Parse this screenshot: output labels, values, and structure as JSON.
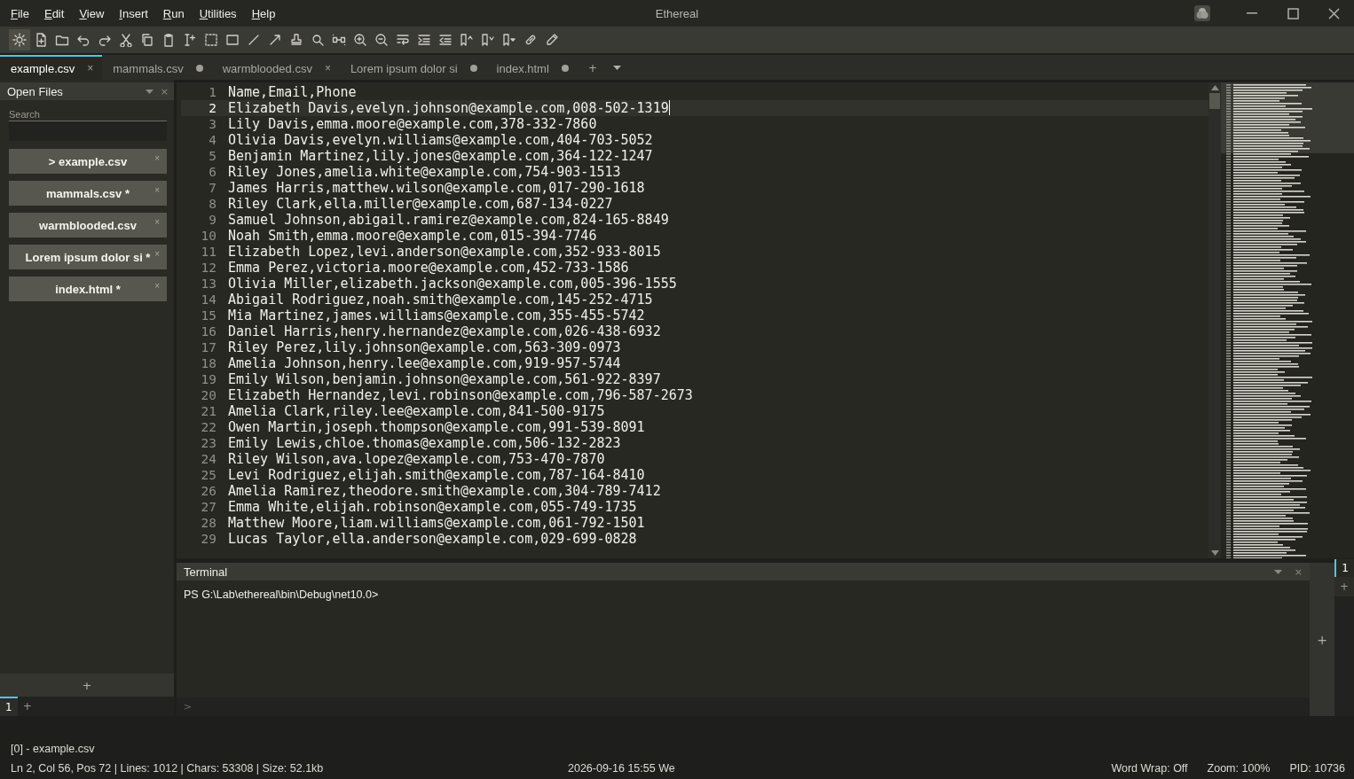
{
  "window": {
    "title": "Ethereal"
  },
  "menu": [
    "File",
    "Edit",
    "View",
    "Insert",
    "Run",
    "Utilities",
    "Help"
  ],
  "toolbar": [
    {
      "selected": true
    },
    {
      "selected": false
    },
    {
      "selected": false
    },
    {
      "selected": false
    },
    {
      "selected": false
    },
    {
      "selected": false
    },
    {
      "selected": false
    },
    {
      "selected": false
    },
    {
      "selected": false
    },
    {
      "selected": false
    },
    {
      "selected": false
    },
    {
      "selected": false
    },
    {
      "selected": false
    },
    {
      "selected": false
    },
    {
      "selected": false
    },
    {
      "selected": false
    },
    {
      "selected": false
    },
    {
      "selected": false
    },
    {
      "selected": false
    },
    {
      "selected": false
    },
    {
      "selected": false
    },
    {
      "selected": false
    },
    {
      "selected": false
    },
    {
      "selected": false
    },
    {
      "selected": false
    },
    {
      "selected": false
    }
  ],
  "tabs": [
    {
      "label": "example.csv",
      "selected": true,
      "kind": "close",
      "close": "×"
    },
    {
      "label": "mammals.csv",
      "selected": false,
      "kind": "modified"
    },
    {
      "label": "warmblooded.csv",
      "selected": false,
      "kind": "close",
      "close": "×"
    },
    {
      "label": "Lorem ipsum dolor si",
      "selected": false,
      "kind": "modified"
    },
    {
      "label": "index.html",
      "selected": false,
      "kind": "modified"
    }
  ],
  "tab_add": "+",
  "sidebar": {
    "title": "Open Files",
    "close": "×",
    "search": {
      "label": "Search"
    },
    "files": [
      {
        "label": "> example.csv",
        "close": "×"
      },
      {
        "label": "mammals.csv *",
        "close": "×"
      },
      {
        "label": "warmblooded.csv",
        "close": "×"
      },
      {
        "label": "Lorem ipsum dolor si *",
        "close": "×"
      },
      {
        "label": "index.html *",
        "close": "×"
      }
    ],
    "add": "+",
    "tabs": [
      {
        "label": "1",
        "selected": true
      }
    ],
    "tab_add": "+"
  },
  "editor": {
    "lines": [
      {
        "n": "1",
        "text": "Name,Email,Phone",
        "current": false
      },
      {
        "n": "2",
        "text": "Elizabeth Davis,evelyn.johnson@example.com,008-502-1319",
        "current": true
      },
      {
        "n": "3",
        "text": "Lily Davis,emma.moore@example.com,378-332-7860",
        "current": false
      },
      {
        "n": "4",
        "text": "Olivia Davis,evelyn.williams@example.com,404-703-5052",
        "current": false
      },
      {
        "n": "5",
        "text": "Benjamin Martinez,lily.jones@example.com,364-122-1247",
        "current": false
      },
      {
        "n": "6",
        "text": "Riley Jones,amelia.white@example.com,754-903-1513",
        "current": false
      },
      {
        "n": "7",
        "text": "James Harris,matthew.wilson@example.com,017-290-1618",
        "current": false
      },
      {
        "n": "8",
        "text": "Riley Clark,ella.miller@example.com,687-134-0227",
        "current": false
      },
      {
        "n": "9",
        "text": "Samuel Johnson,abigail.ramirez@example.com,824-165-8849",
        "current": false
      },
      {
        "n": "10",
        "text": "Noah Smith,emma.moore@example.com,015-394-7746",
        "current": false
      },
      {
        "n": "11",
        "text": "Elizabeth Lopez,levi.anderson@example.com,352-933-8015",
        "current": false
      },
      {
        "n": "12",
        "text": "Emma Perez,victoria.moore@example.com,452-733-1586",
        "current": false
      },
      {
        "n": "13",
        "text": "Olivia Miller,elizabeth.jackson@example.com,005-396-1555",
        "current": false
      },
      {
        "n": "14",
        "text": "Abigail Rodriguez,noah.smith@example.com,145-252-4715",
        "current": false
      },
      {
        "n": "15",
        "text": "Mia Martinez,james.williams@example.com,355-455-5742",
        "current": false
      },
      {
        "n": "16",
        "text": "Daniel Harris,henry.hernandez@example.com,026-438-6932",
        "current": false
      },
      {
        "n": "17",
        "text": "Riley Perez,lily.johnson@example.com,563-309-0973",
        "current": false
      },
      {
        "n": "18",
        "text": "Amelia Johnson,henry.lee@example.com,919-957-5744",
        "current": false
      },
      {
        "n": "19",
        "text": "Emily Wilson,benjamin.johnson@example.com,561-922-8397",
        "current": false
      },
      {
        "n": "20",
        "text": "Elizabeth Hernandez,levi.robinson@example.com,796-587-2673",
        "current": false
      },
      {
        "n": "21",
        "text": "Amelia Clark,riley.lee@example.com,841-500-9175",
        "current": false
      },
      {
        "n": "22",
        "text": "Owen Martin,joseph.thompson@example.com,991-539-8091",
        "current": false
      },
      {
        "n": "23",
        "text": "Emily Lewis,chloe.thomas@example.com,506-132-2823",
        "current": false
      },
      {
        "n": "24",
        "text": "Riley Wilson,ava.lopez@example.com,753-470-7870",
        "current": false
      },
      {
        "n": "25",
        "text": "Levi Rodriguez,elijah.smith@example.com,787-164-8410",
        "current": false
      },
      {
        "n": "26",
        "text": "Amelia Ramirez,theodore.smith@example.com,304-789-7412",
        "current": false
      },
      {
        "n": "27",
        "text": "Emma White,elijah.robinson@example.com,055-749-1735",
        "current": false
      },
      {
        "n": "28",
        "text": "Matthew Moore,liam.williams@example.com,061-792-1501",
        "current": false
      },
      {
        "n": "29",
        "text": "Lucas Taylor,ella.anderson@example.com,029-699-0828",
        "current": false
      }
    ]
  },
  "terminal": {
    "title": "Terminal",
    "close": "×",
    "prompt": "PS G:\\Lab\\ethereal\\bin\\Debug\\net10.0>",
    "add": "+",
    "input_prompt": ">",
    "tabs": [
      {
        "label": "1",
        "selected": true
      }
    ],
    "tab_add": "+"
  },
  "status_bar": {
    "file": "[0] - example.csv",
    "position": "Ln 2, Col 56, Pos 72 | Lines: 1012 | Chars: 53308 | Size: 52.1kb",
    "datetime": "2026-09-16 15:55 We",
    "word_wrap": "Word Wrap: Off",
    "zoom": "Zoom: 100%",
    "pid": "PID: 10736"
  }
}
